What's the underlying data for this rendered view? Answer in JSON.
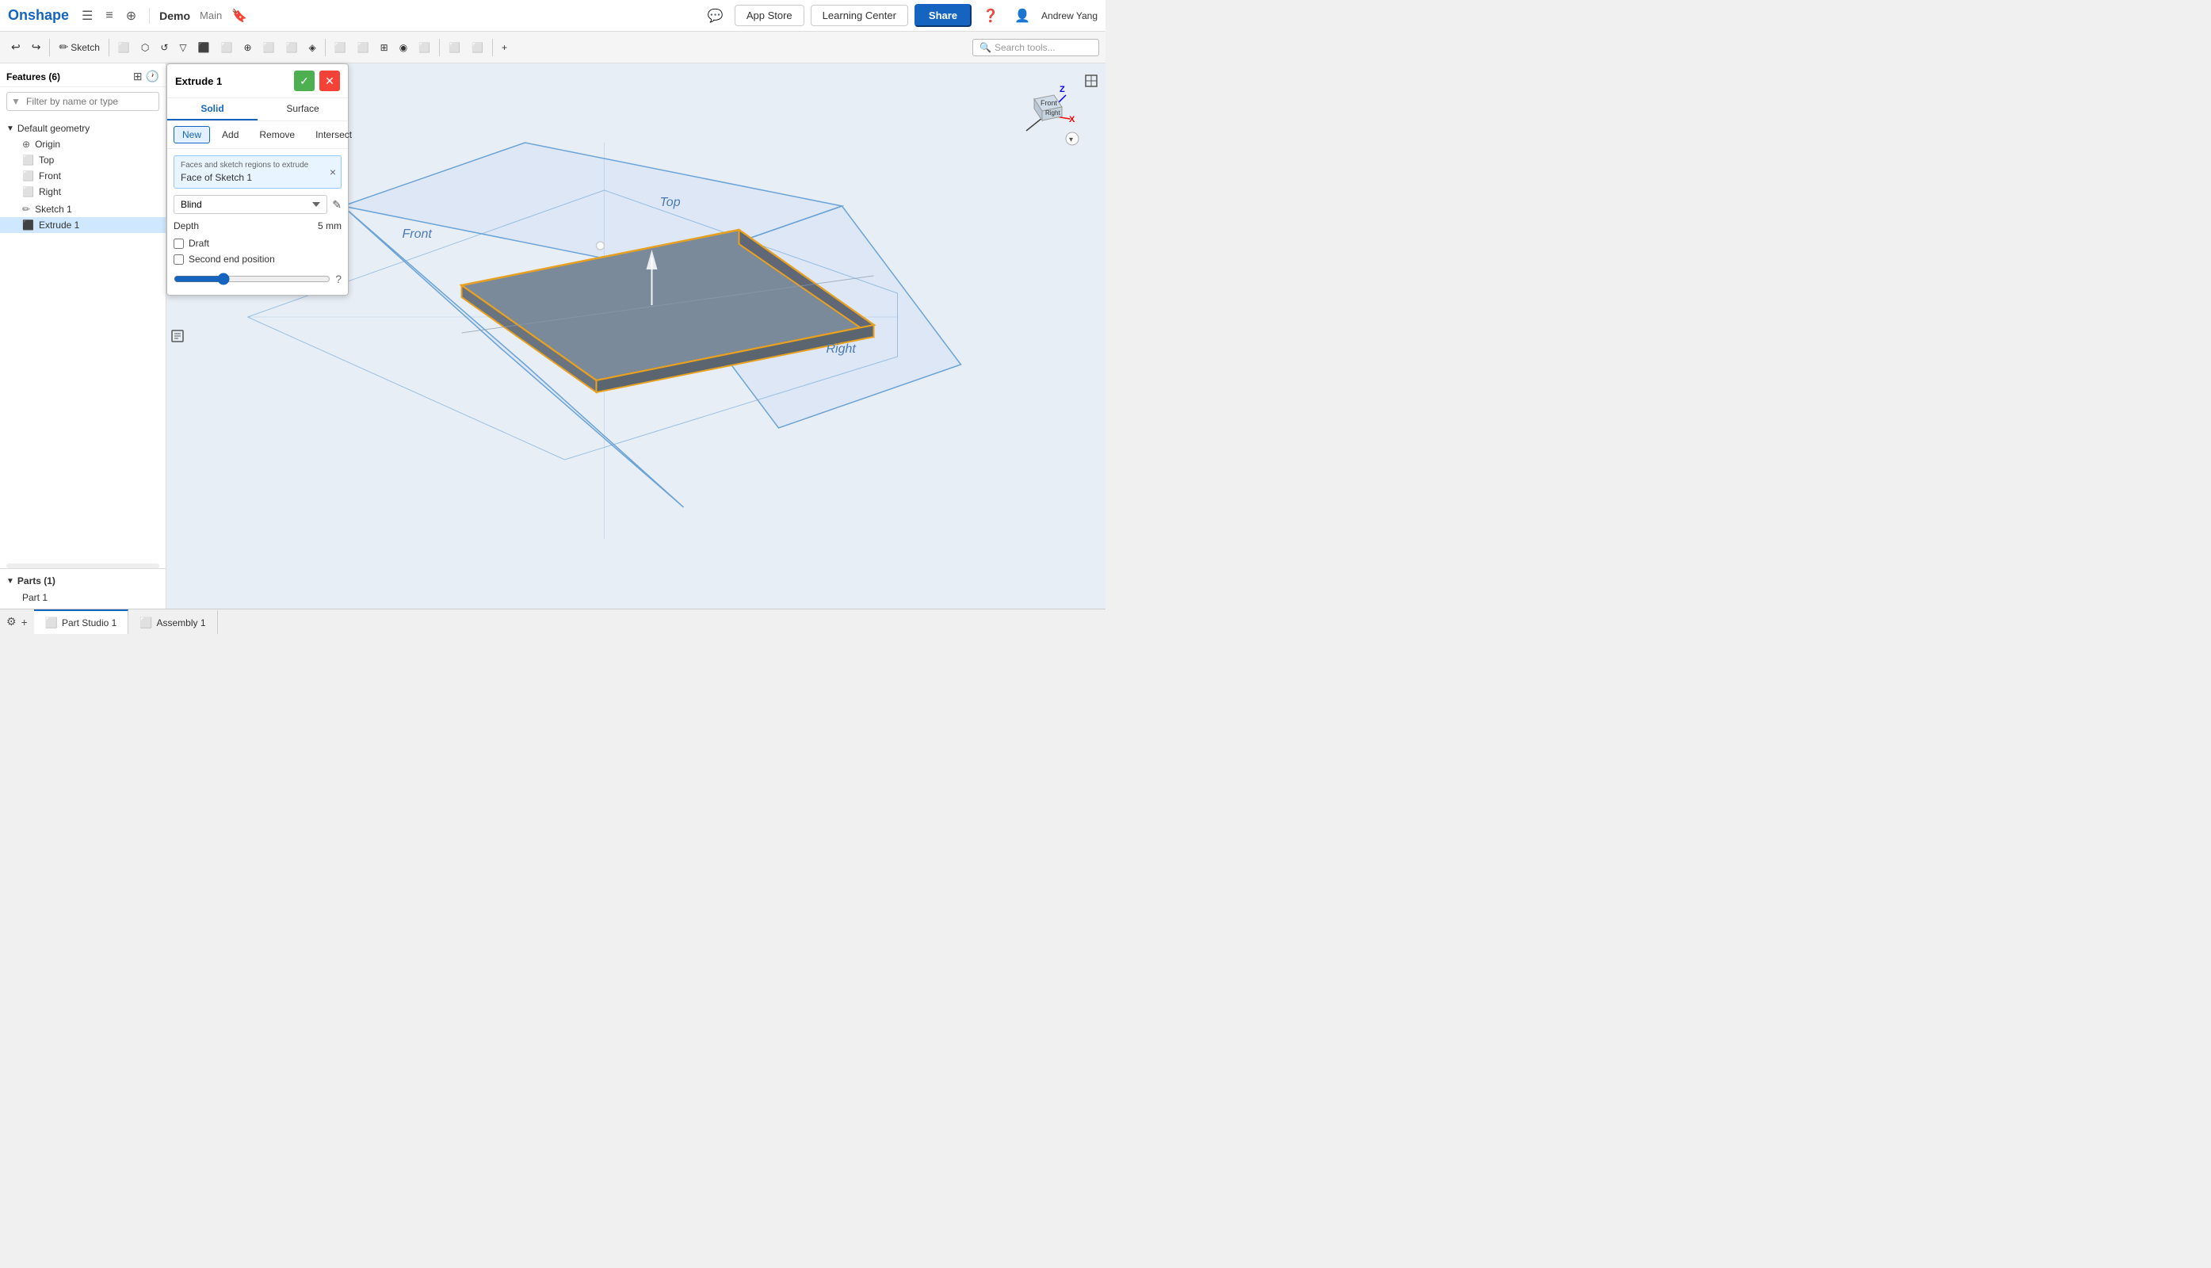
{
  "app": {
    "logo": "Onshape",
    "doc_title": "Demo",
    "doc_branch": "Main",
    "nav_icons": [
      "☰",
      "≡≡",
      "+|"
    ],
    "app_store_label": "App Store",
    "learning_center_label": "Learning Center",
    "share_label": "Share",
    "help_icon": "?",
    "user_name": "Andrew Yang"
  },
  "toolbar": {
    "sketch_label": "Sketch",
    "search_placeholder": "Search tools...",
    "tools": [
      "↩",
      "↪",
      "✏",
      "⬜",
      "↺",
      "⬡",
      "△",
      "⬛",
      "◎",
      "⬜",
      "⬜",
      "⬜",
      "⬜",
      "⬜",
      "⬜",
      "⬜",
      "⬜",
      "⬜",
      "⬜",
      "⬜"
    ]
  },
  "features_panel": {
    "title": "Features (6)",
    "filter_placeholder": "Filter by name or type",
    "items": [
      {
        "label": "Default geometry",
        "type": "group",
        "expanded": true
      },
      {
        "label": "Origin",
        "type": "origin",
        "indent": true
      },
      {
        "label": "Top",
        "type": "plane",
        "indent": true
      },
      {
        "label": "Front",
        "type": "plane",
        "indent": true
      },
      {
        "label": "Right",
        "type": "plane",
        "indent": true
      },
      {
        "label": "Sketch 1",
        "type": "sketch",
        "indent": false
      },
      {
        "label": "Extrude 1",
        "type": "extrude",
        "indent": false,
        "active": true
      }
    ],
    "parts_section": {
      "title": "Parts (1)",
      "items": [
        "Part 1"
      ]
    }
  },
  "extrude_panel": {
    "title": "Extrude 1",
    "confirm_label": "✓",
    "cancel_label": "✕",
    "tabs": [
      "Solid",
      "Surface"
    ],
    "active_tab": "Solid",
    "subtabs": [
      "New",
      "Add",
      "Remove",
      "Intersect"
    ],
    "active_subtab": "New",
    "face_label": "Faces and sketch regions to extrude",
    "face_value": "Face of Sketch 1",
    "depth_type": "Blind",
    "depth_label": "Depth",
    "depth_value": "5 mm",
    "draft_label": "Draft",
    "second_end_label": "Second end position",
    "help_icon": "?"
  },
  "scene": {
    "labels": {
      "front": "Front",
      "top": "Top",
      "right": "Right"
    }
  },
  "bottom_tabs": [
    {
      "label": "Part Studio 1",
      "active": true
    },
    {
      "label": "Assembly 1",
      "active": false
    }
  ],
  "view_cube": {
    "front_label": "Front",
    "right_label": "Right"
  }
}
